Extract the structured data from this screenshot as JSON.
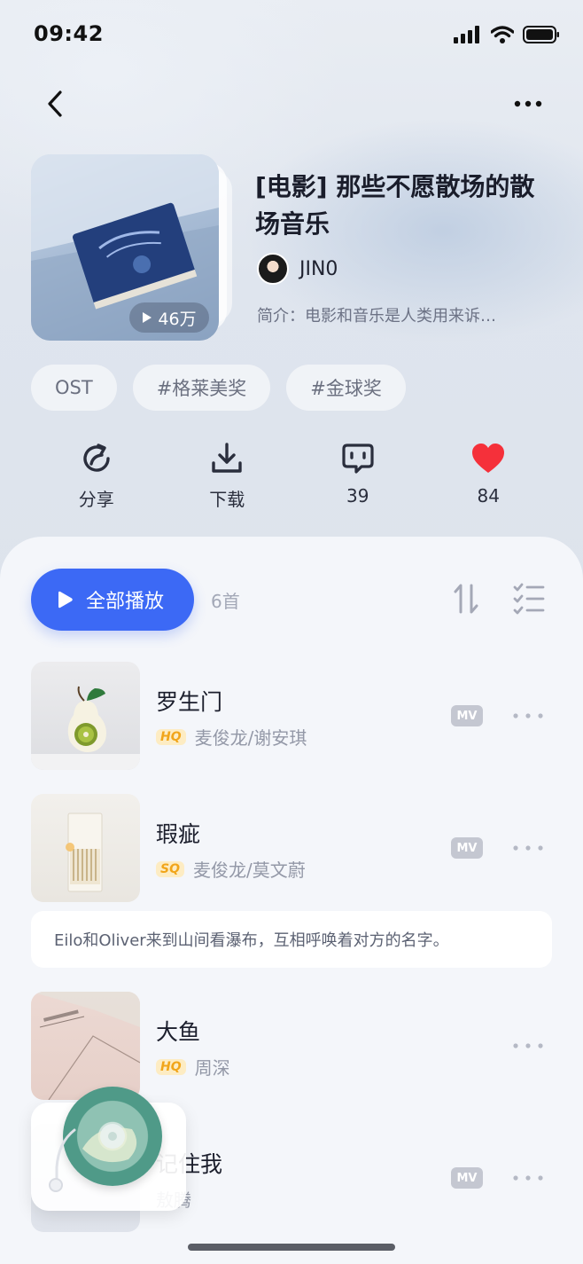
{
  "status_bar": {
    "time": "09:42"
  },
  "playlist": {
    "title": "[电影] 那些不愿散场的散场音乐",
    "play_count": "46万",
    "author": "JIN0",
    "intro": "简介：电影和音乐是人类用来诉…",
    "tags": [
      "OST",
      "#格莱美奖",
      "#金球奖"
    ]
  },
  "actions": {
    "share": "分享",
    "download": "下载",
    "comments": "39",
    "likes": "84"
  },
  "list_header": {
    "play_all": "全部播放",
    "count": "6首"
  },
  "songs": [
    {
      "title": "罗生门",
      "quality": "HQ",
      "artist": "麦俊龙/谢安琪",
      "mv": "MV"
    },
    {
      "title": "瑕疵",
      "quality": "SQ",
      "artist": "麦俊龙/莫文蔚",
      "mv": "MV"
    },
    {
      "title": "大鱼",
      "quality": "HQ",
      "artist": "周深"
    },
    {
      "title": "记住我",
      "artist": "敖腾",
      "mv": "MV"
    }
  ],
  "note": "Eilo和Oliver来到山间看瀑布，互相呼唤着对方的名字。",
  "colors": {
    "accent": "#3c69f5",
    "like": "#f5303a",
    "quality": "#f1a51a"
  }
}
